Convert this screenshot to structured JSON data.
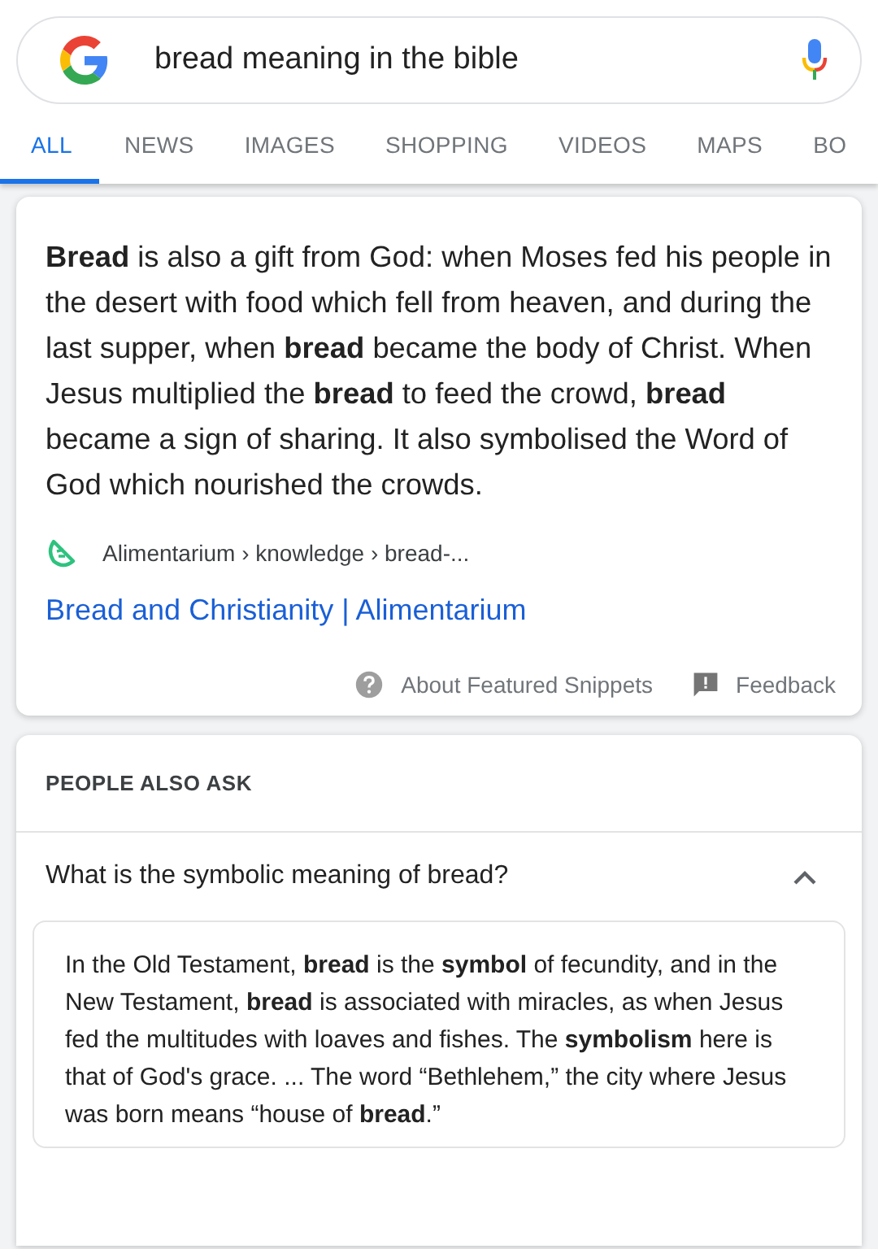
{
  "search": {
    "value": "bread meaning in the bible"
  },
  "tabs": [
    {
      "label": "ALL",
      "selected": true
    },
    {
      "label": "NEWS",
      "selected": false
    },
    {
      "label": "IMAGES",
      "selected": false
    },
    {
      "label": "SHOPPING",
      "selected": false
    },
    {
      "label": "VIDEOS",
      "selected": false
    },
    {
      "label": "MAPS",
      "selected": false
    },
    {
      "label": "BO",
      "selected": false
    }
  ],
  "featured_snippet": {
    "text": "**Bread** is also a gift from God: when Moses fed his people in the desert with food which fell from heaven, and during the last supper, when **bread** became the body of Christ. When Jesus multiplied the **bread** to feed the crowd, **bread** became a sign of sharing. It also symbolised the Word of God which nourished the crowds.",
    "source": "Alimentarium › knowledge › bread-...",
    "link": "Bread and Christianity | Alimentarium",
    "footer": [
      "About Featured Snippets",
      "Feedback"
    ]
  },
  "people_also_ask": {
    "heading": "PEOPLE ALSO ASK",
    "questions": [
      {
        "question": "What is the symbolic meaning of bread?",
        "expanded": true,
        "answer": "In the Old Testament, **bread** is the **symbol** of fecundity, and in the New Testament, **bread** is associated with miracles, as when Jesus fed the multitudes with loaves and fishes. The **symbolism** here is that of God's grace. ... The word “Bethlehem,” the city where Jesus was born means “house of **bread**.”"
      }
    ]
  }
}
